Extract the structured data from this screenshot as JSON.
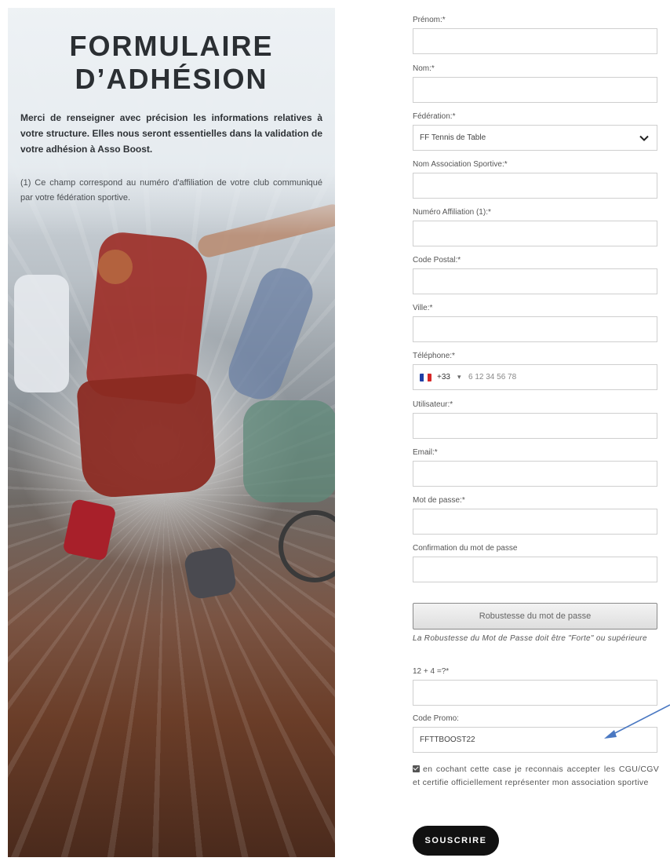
{
  "hero": {
    "title_line1": "FORMULAIRE",
    "title_line2": "D’ADHÉSION",
    "intro": "Merci de renseigner avec précision les informations relatives à votre structure. Elles nous seront essentielles dans la validation de votre adhésion à Asso Boost.",
    "note": "(1) Ce champ correspond au numéro d'affiliation de votre club communiqué par votre fédération sportive."
  },
  "form": {
    "prenom_label": "Prénom:*",
    "nom_label": "Nom:*",
    "federation_label": "Fédération:*",
    "federation_value": "FF Tennis de Table",
    "association_label": "Nom Association Sportive:*",
    "affiliation_label": "Numéro Affiliation (1):*",
    "code_postal_label": "Code Postal:*",
    "ville_label": "Ville:*",
    "telephone_label": "Téléphone:*",
    "phone_country_code": "+33",
    "phone_placeholder": "6 12 34 56 78",
    "utilisateur_label": "Utilisateur:*",
    "email_label": "Email:*",
    "password_label": "Mot de passe:*",
    "confirm_password_label": "Confirmation du mot de passe",
    "strength_button": "Robustesse du mot de passe",
    "strength_hint": "La Robustesse du Mot de Passe doit être \"Forte\" ou supérieure",
    "captcha_label": "12 + 4 =?*",
    "promo_label": "Code Promo:",
    "promo_value": "FFTTBOOST22",
    "consent_text": "en cochant cette case je reconnais accepter les CGU/CGV et certifie officiellement représenter mon association sportive",
    "consent_checked": true,
    "submit_label": "SOUSCRIRE"
  },
  "colors": {
    "submit_bg": "#111111",
    "arrow": "#4a78c2",
    "flag_blue": "#1f3fa6",
    "flag_red": "#d62828"
  },
  "icons": {
    "select": "chevron-down-icon",
    "flag": "france-flag-icon",
    "arrow": "annotation-arrow-icon",
    "checkbox": "checkbox-checked-icon"
  }
}
